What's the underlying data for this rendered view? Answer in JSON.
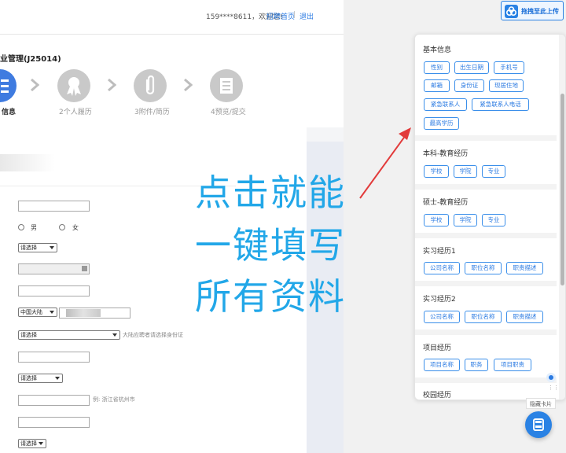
{
  "topbar": {
    "user_text": "159****8611，欢迎您!",
    "home_link": "招聘首页",
    "separator": "|",
    "logout": "退出"
  },
  "job": {
    "title": "业管理(J25014)"
  },
  "steps": [
    {
      "label": "信息",
      "icon": "list-icon",
      "active": true
    },
    {
      "label": "2个人履历",
      "icon": "award-icon",
      "active": false
    },
    {
      "label": "3附件/简历",
      "icon": "paperclip-icon",
      "active": false
    },
    {
      "label": "4预览/提交",
      "icon": "document-icon",
      "active": false
    }
  ],
  "form": {
    "gender_male": "男",
    "gender_female": "女",
    "select_placeholder": "请选择",
    "region_value": "中国大陆",
    "id_hint": "大陆应聘者请选择身份证",
    "address_hint": "例: 浙江省杭州市"
  },
  "overlay": {
    "line1": "点击就能",
    "line2": "一键填写",
    "line3": "所有资料"
  },
  "upload": {
    "label": "拖拽至此上传",
    "icon": "cloud-icon"
  },
  "panel": {
    "sections": [
      {
        "title": "基本信息",
        "chips": [
          "性别",
          "出生日期",
          "手机号",
          "邮箱",
          "身份证",
          "现居住地",
          "紧急联系人",
          "紧急联系人电话",
          "最高学历"
        ]
      },
      {
        "title": "本科-教育经历",
        "chips": [
          "学校",
          "学院",
          "专业"
        ]
      },
      {
        "title": "硕士-教育经历",
        "chips": [
          "学校",
          "学院",
          "专业"
        ]
      },
      {
        "title": "实习经历1",
        "chips": [
          "公司名称",
          "职位名称",
          "职责描述"
        ]
      },
      {
        "title": "实习经历2",
        "chips": [
          "公司名称",
          "职位名称",
          "职责描述"
        ]
      },
      {
        "title": "项目经历",
        "chips": [
          "项目名称",
          "职务",
          "项目职责"
        ]
      },
      {
        "title": "校园经历",
        "chips": []
      }
    ]
  },
  "floating": {
    "label": "隐藏卡片",
    "dots": "⋮⋮"
  },
  "colors": {
    "accent": "#2a82e4",
    "overlay_text": "#22a7e8",
    "arrow": "#e23b3b",
    "step_active": "#3f7be0"
  }
}
